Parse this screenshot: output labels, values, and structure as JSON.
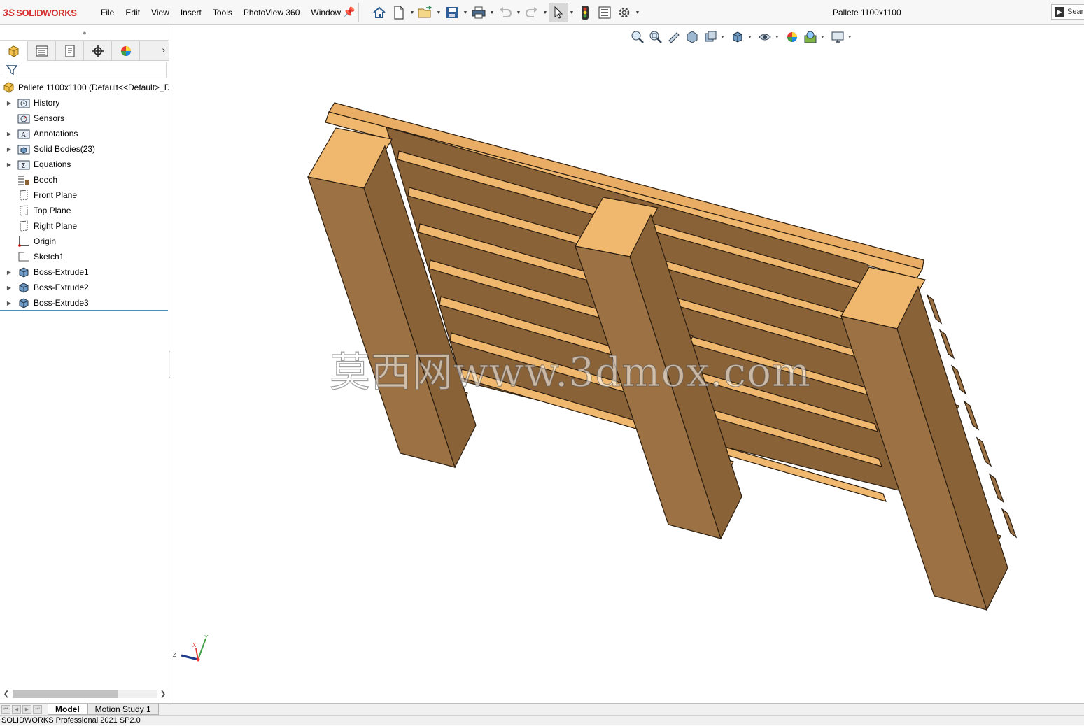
{
  "app": {
    "logo_mark": "3S",
    "logo_text": "SOLIDWORKS",
    "document_title": "Pallete 1100x1100",
    "search_label": "Sear"
  },
  "menu": [
    "File",
    "Edit",
    "View",
    "Insert",
    "Tools",
    "PhotoView 360",
    "Window"
  ],
  "toolbar_icons": [
    "home-icon",
    "new-document-icon",
    "open-icon",
    "save-icon",
    "print-icon",
    "undo-icon",
    "redo-icon",
    "select-icon",
    "rebuild-icon",
    "file-properties-icon",
    "options-icon"
  ],
  "feature_tree": {
    "root": "Pallete 1100x1100  (Default<<Default>_D",
    "items": [
      {
        "label": "History",
        "icon": "history-folder-icon",
        "expandable": true
      },
      {
        "label": "Sensors",
        "icon": "sensors-folder-icon",
        "expandable": false
      },
      {
        "label": "Annotations",
        "icon": "annotations-folder-icon",
        "expandable": true
      },
      {
        "label": "Solid Bodies(23)",
        "icon": "solid-bodies-folder-icon",
        "expandable": true
      },
      {
        "label": "Equations",
        "icon": "equations-folder-icon",
        "expandable": true
      },
      {
        "label": "Beech",
        "icon": "material-icon",
        "expandable": false
      },
      {
        "label": "Front Plane",
        "icon": "plane-icon",
        "expandable": false
      },
      {
        "label": "Top Plane",
        "icon": "plane-icon",
        "expandable": false
      },
      {
        "label": "Right Plane",
        "icon": "plane-icon",
        "expandable": false
      },
      {
        "label": "Origin",
        "icon": "origin-icon",
        "expandable": false
      },
      {
        "label": "Sketch1",
        "icon": "sketch-icon",
        "expandable": false
      },
      {
        "label": "Boss-Extrude1",
        "icon": "boss-extrude-icon",
        "expandable": true
      },
      {
        "label": "Boss-Extrude2",
        "icon": "boss-extrude-icon",
        "expandable": true
      },
      {
        "label": "Boss-Extrude3",
        "icon": "boss-extrude-icon",
        "expandable": true
      }
    ]
  },
  "bottom_tabs": [
    "Model",
    "Motion Study 1"
  ],
  "status_text": "SOLIDWORKS Professional 2021 SP2.0",
  "watermark": "莫西网www.3dmox.com",
  "triad": {
    "x": "X",
    "y": "Y",
    "z": "Z"
  },
  "colors": {
    "accent_red": "#d32f2f",
    "wood_dark": "#8a6238",
    "wood_side": "#9c7244",
    "wood_light": "#f0b86e",
    "wood_top": "#e9ad66"
  }
}
